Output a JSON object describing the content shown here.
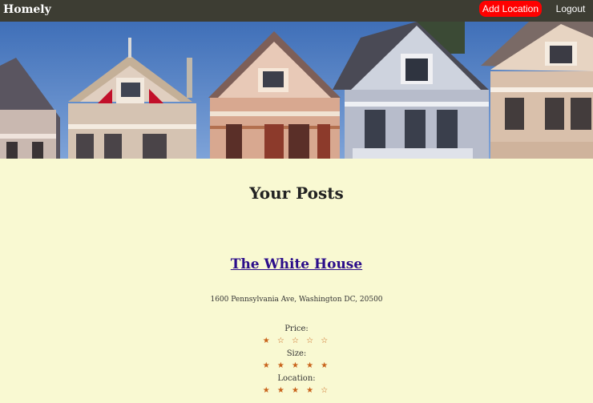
{
  "nav": {
    "brand": "Homely",
    "add_location": "Add Location",
    "logout": "Logout"
  },
  "colors": {
    "nav_bg": "#3d3d33",
    "page_bg": "#f9f9d2",
    "accent_button": "#ff0000",
    "link": "#2b0d8a",
    "star": "#c8621a"
  },
  "hero": {
    "image": "row-of-victorian-houses"
  },
  "page": {
    "title": "Your Posts"
  },
  "post": {
    "title": "The White House",
    "address": "1600 Pennsylvania Ave, Washington DC, 20500",
    "ratings": [
      {
        "label": "Price:",
        "value": 1,
        "max": 5,
        "stars": "★ ☆ ☆ ☆ ☆"
      },
      {
        "label": "Size:",
        "value": 5,
        "max": 5,
        "stars": "★ ★ ★ ★ ★"
      },
      {
        "label": "Location:",
        "value": 4,
        "max": 5,
        "stars": "★ ★ ★ ★ ☆"
      }
    ]
  }
}
